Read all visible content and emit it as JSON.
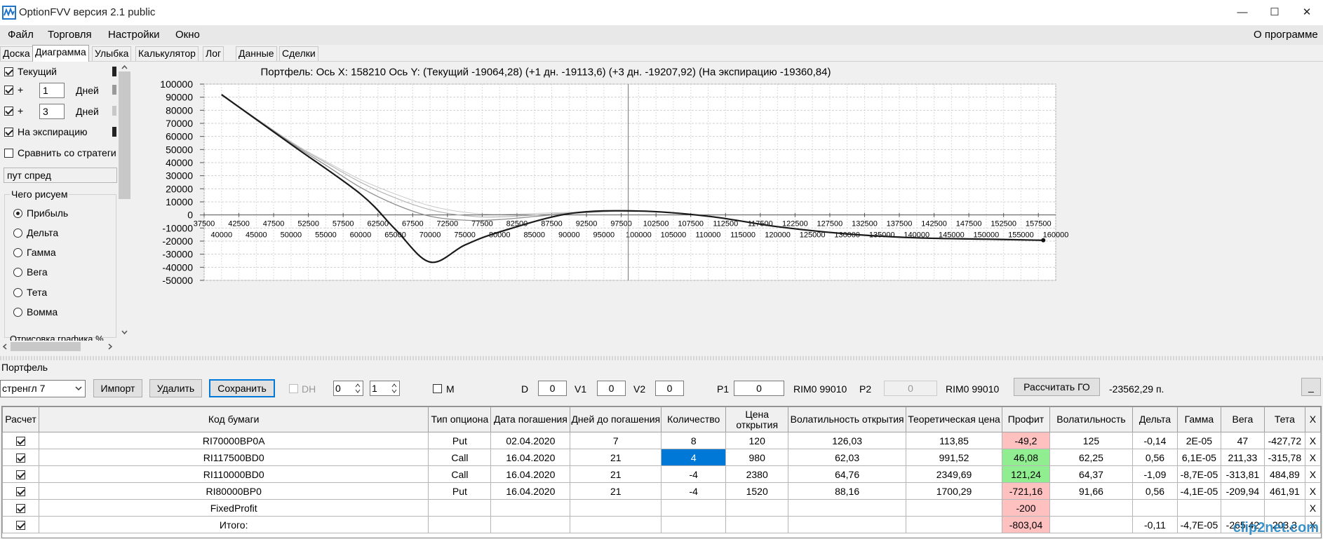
{
  "window": {
    "title": "OptionFVV версия 2.1 public",
    "minimize": "—",
    "maximize": "☐",
    "close": "✕"
  },
  "menu": [
    "Файл",
    "Торговля",
    "Настройки",
    "Окно"
  ],
  "menu_about": "О программе",
  "tabs": [
    "Доска",
    "Диаграмма",
    "Улыбка",
    "Калькулятор",
    "Лог",
    "Данные",
    "Сделки"
  ],
  "active_tab": 1,
  "side": {
    "current": "Текущий",
    "plus": "+",
    "days": "Дней",
    "days1": "1",
    "days2": "3",
    "expiration": "На экспирацию",
    "compare": "Сравнить со стратеги",
    "strategy": "пут спред",
    "what_group": "Чего рисуем",
    "radios": [
      "Прибыль",
      "Дельта",
      "Гамма",
      "Вега",
      "Тета",
      "Вомма"
    ],
    "selected_radio": 0,
    "render_label": "Отрисовка графика %"
  },
  "chart_data": {
    "type": "line",
    "title": "Портфель: Ось X: 158210 Ось Y:  (Текущий -19064,28)  (+1 дн. -19113,6)  (+3 дн. -19207,92)  (На экспирацию -19360,84)",
    "xlim": [
      37500,
      160000
    ],
    "ylim": [
      -50000,
      100000
    ],
    "x_ticks_top": [
      "37500",
      "42500",
      "47500",
      "52500",
      "57500",
      "62500",
      "67500",
      "72500",
      "77500",
      "82500",
      "87500",
      "92500",
      "97500",
      "102500",
      "107500",
      "112500",
      "117500",
      "122500",
      "127500",
      "132500",
      "137500",
      "142500",
      "147500",
      "152500",
      "157500"
    ],
    "x_ticks_bottom": [
      "40000",
      "45000",
      "50000",
      "55000",
      "60000",
      "65000",
      "70000",
      "75000",
      "80000",
      "85000",
      "90000",
      "95000",
      "100000",
      "105000",
      "110000",
      "115000",
      "120000",
      "125000",
      "130000",
      "135000",
      "140000",
      "145000",
      "150000",
      "155000",
      "160000"
    ],
    "y_ticks": [
      "100000",
      "90000",
      "80000",
      "70000",
      "60000",
      "50000",
      "40000",
      "30000",
      "20000",
      "10000",
      "0",
      "-10000",
      "-20000",
      "-30000",
      "-40000",
      "-50000"
    ],
    "cursor_x": 98500,
    "grid": true,
    "series": [
      {
        "color": "#1a1a1a",
        "width": 2.2,
        "x": [
          40000,
          50000,
          60000,
          65000,
          70000,
          75000,
          80000,
          90000,
          100000,
          110000,
          120000,
          130000,
          140000,
          150000,
          158210
        ],
        "y": [
          92000,
          54000,
          16000,
          -11000,
          -36000,
          -23000,
          -13000,
          1000,
          3000,
          -1000,
          -9000,
          -14500,
          -17500,
          -18500,
          -19360
        ]
      },
      {
        "color": "#909090",
        "width": 1.3,
        "x": [
          40000,
          50000,
          55000,
          60000,
          65000,
          70000,
          75000,
          80000,
          90000,
          100000,
          110000,
          120000,
          130000,
          140000,
          150000,
          158210
        ],
        "y": [
          92000,
          55000,
          38000,
          21000,
          8000,
          -1000,
          -4000,
          -3500,
          1000,
          3000,
          -1000,
          -9000,
          -14500,
          -17500,
          -18800,
          -19200
        ]
      },
      {
        "color": "#b0b0b0",
        "width": 1.1,
        "x": [
          40000,
          50000,
          55000,
          60000,
          65000,
          70000,
          75000,
          80000,
          90000,
          100000,
          110000,
          120000,
          130000,
          140000,
          150000,
          158210
        ],
        "y": [
          92000,
          55500,
          40000,
          25000,
          13000,
          4000,
          -500,
          -1500,
          1500,
          3200,
          -800,
          -8800,
          -14300,
          -17300,
          -18600,
          -19100
        ]
      },
      {
        "color": "#c8c8c8",
        "width": 1.0,
        "x": [
          40000,
          50000,
          55000,
          60000,
          65000,
          70000,
          75000,
          80000,
          90000,
          100000,
          110000,
          120000,
          130000,
          140000,
          150000,
          158210
        ],
        "y": [
          92000,
          56000,
          41000,
          27000,
          16000,
          7000,
          2000,
          500,
          2000,
          3300,
          -700,
          -8700,
          -14200,
          -17200,
          -18500,
          -19064
        ]
      }
    ]
  },
  "portfolio": {
    "label": "Портфель",
    "name": "стренгл 7",
    "import": "Импорт",
    "delete": "Удалить",
    "save": "Сохранить",
    "dh": "DH",
    "spin1": "0",
    "spin2": "1",
    "m": "M",
    "d_label": "D",
    "d_val": "0",
    "v1_label": "V1",
    "v1_val": "0",
    "v2_label": "V2",
    "v2_val": "0",
    "p1_label": "P1",
    "p1_val": "0",
    "p1_ticker": "RIM0 99010",
    "p2_label": "P2",
    "p2_val": "0",
    "p2_ticker": "RIM0 99010",
    "calc_go": "Рассчитать ГО",
    "go_value": "-23562,29 п.",
    "collapse": "_"
  },
  "table": {
    "headers": [
      "Расчет",
      "Код бумаги",
      "Тип опциона",
      "Дата погашения",
      "Дней до погашения",
      "Количество",
      "Цена открытия",
      "Волатильность открытия",
      "Теоретическая цена",
      "Профит",
      "Волатильность",
      "Дельта",
      "Гамма",
      "Вега",
      "Тета",
      "X"
    ],
    "rows": [
      {
        "code": "RI70000BP0A",
        "type": "Put",
        "date": "02.04.2020",
        "days": "7",
        "qty": "8",
        "price": "120",
        "vol_open": "126,03",
        "theo": "113,85",
        "profit": "-49,2",
        "profit_color": "pink",
        "vol": "125",
        "delta": "-0,14",
        "gamma": "2E-05",
        "vega": "47",
        "theta": "-427,72",
        "x": "X"
      },
      {
        "code": "RI117500BD0",
        "type": "Call",
        "date": "16.04.2020",
        "days": "21",
        "qty": "4",
        "qty_selected": true,
        "price": "980",
        "vol_open": "62,03",
        "theo": "991,52",
        "profit": "46,08",
        "profit_color": "green",
        "vol": "62,25",
        "delta": "0,56",
        "gamma": "6,1E-05",
        "vega": "211,33",
        "theta": "-315,78",
        "x": "X"
      },
      {
        "code": "RI110000BD0",
        "type": "Call",
        "date": "16.04.2020",
        "days": "21",
        "qty": "-4",
        "price": "2380",
        "vol_open": "64,76",
        "theo": "2349,69",
        "profit": "121,24",
        "profit_color": "green",
        "vol": "64,37",
        "delta": "-1,09",
        "gamma": "-8,7E-05",
        "vega": "-313,81",
        "theta": "484,89",
        "x": "X"
      },
      {
        "code": "RI80000BP0",
        "type": "Put",
        "date": "16.04.2020",
        "days": "21",
        "qty": "-4",
        "price": "1520",
        "vol_open": "88,16",
        "theo": "1700,29",
        "profit": "-721,16",
        "profit_color": "pink",
        "vol": "91,66",
        "delta": "0,56",
        "gamma": "-4,1E-05",
        "vega": "-209,94",
        "theta": "461,91",
        "x": "X"
      },
      {
        "code": "FixedProfit",
        "type": "",
        "date": "",
        "days": "",
        "qty": "",
        "price": "",
        "vol_open": "",
        "theo": "",
        "profit": "-200",
        "profit_color": "pink",
        "vol": "",
        "delta": "",
        "gamma": "",
        "vega": "",
        "theta": "",
        "x": "X"
      },
      {
        "code": "Итого:",
        "type": "",
        "date": "",
        "days": "",
        "qty": "",
        "price": "",
        "vol_open": "",
        "theo": "",
        "profit": "-803,04",
        "profit_color": "pink",
        "vol": "",
        "delta": "-0,11",
        "gamma": "-4,7E-05",
        "vega": "-265,42",
        "theta": "203,3",
        "x": "X"
      }
    ]
  },
  "watermark": "clip2net.com"
}
